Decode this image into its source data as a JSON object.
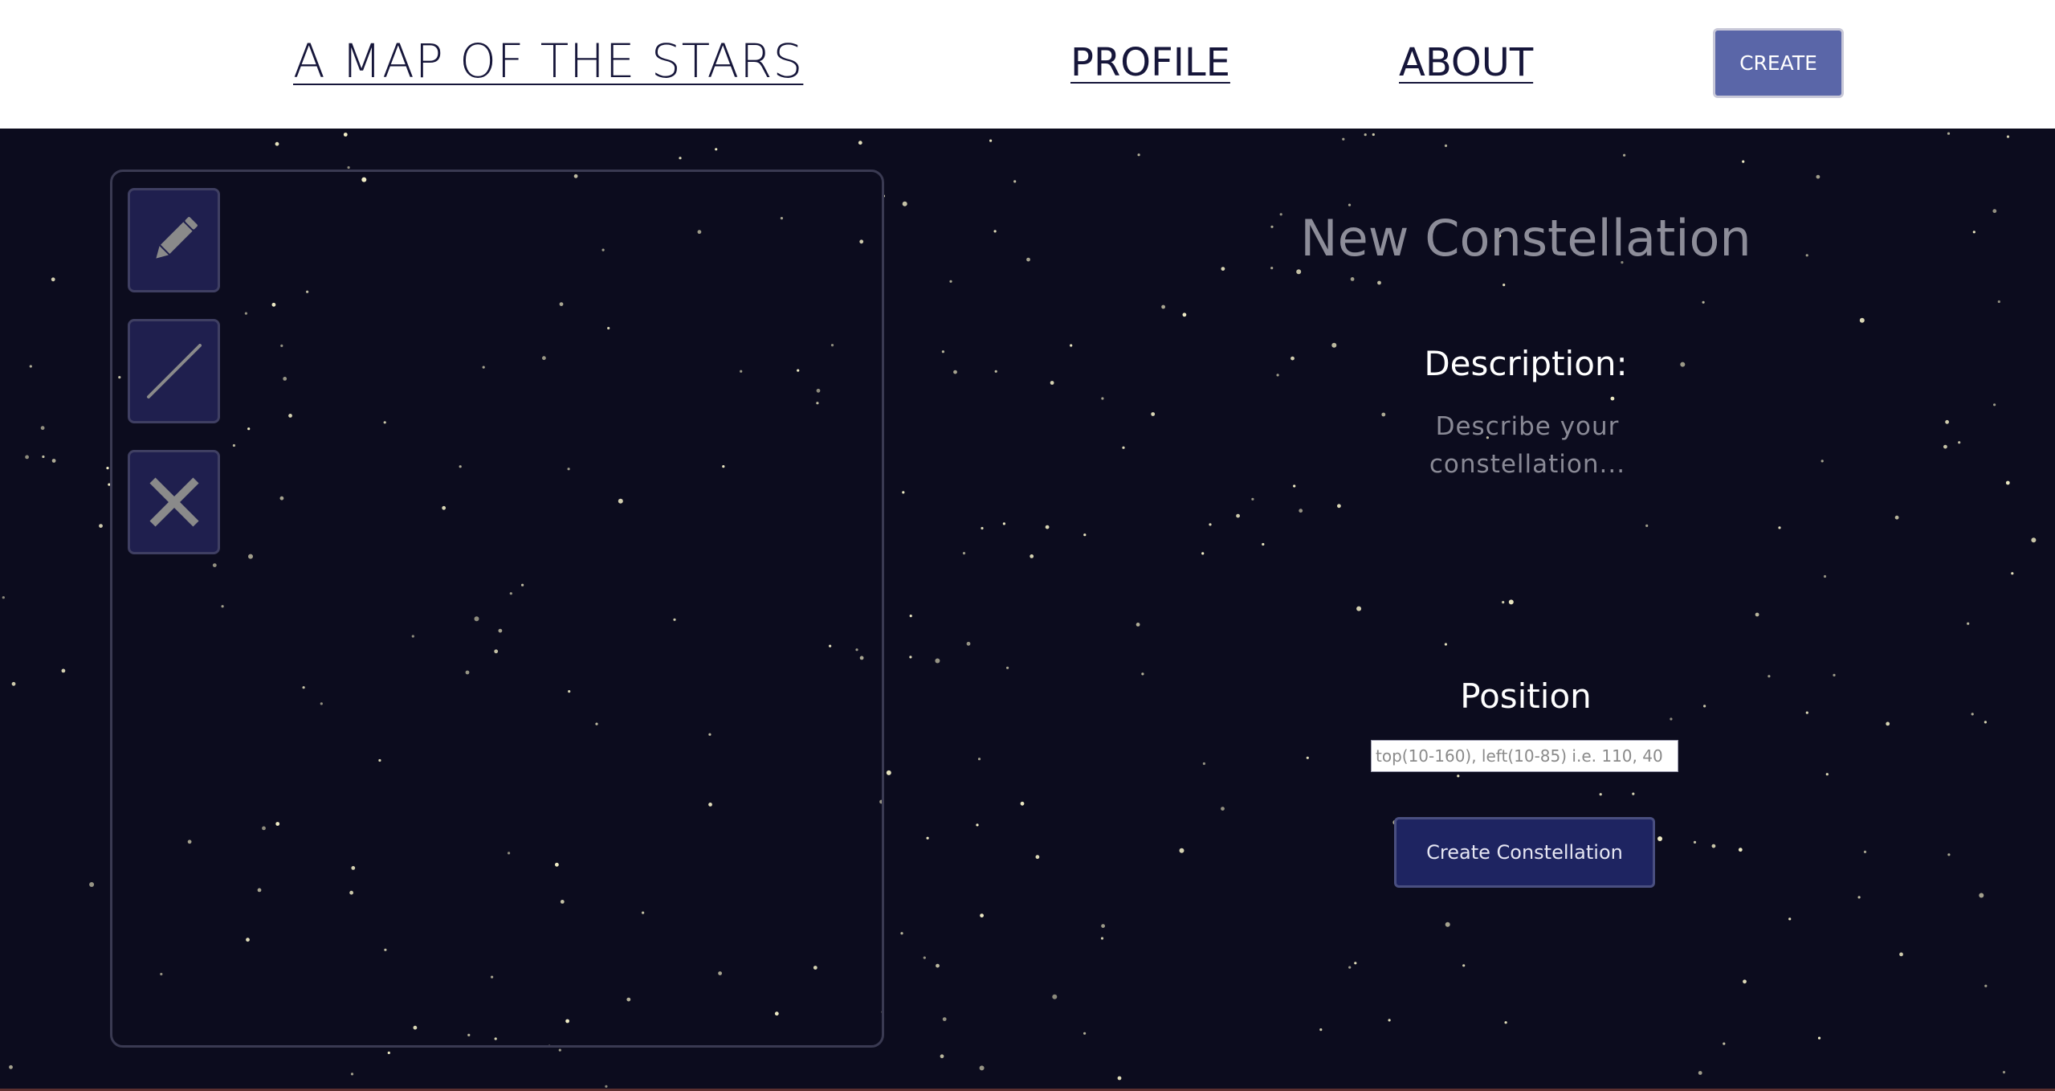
{
  "header": {
    "brand": "A MAP OF THE STARS",
    "nav": {
      "profile": "PROFILE",
      "about": "ABOUT"
    },
    "create_label": "CREATE"
  },
  "tools": [
    {
      "name": "pencil",
      "icon": "pencil-icon"
    },
    {
      "name": "line",
      "icon": "line-icon"
    },
    {
      "name": "delete",
      "icon": "close-icon"
    }
  ],
  "form": {
    "title": "New Constellation",
    "description_label": "Description:",
    "description_placeholder": "Describe your constellation...",
    "position_label": "Position",
    "position_placeholder": "top(10-160), left(10-85) i.e. 110, 40",
    "submit_label": "Create Constellation"
  },
  "colors": {
    "background": "#0c0c1e",
    "header_bg": "#ffffff",
    "brand_text": "#16163a",
    "create_button": "#5a66a8",
    "submit_button": "#1e2461",
    "tool_button": "#1f1f4e",
    "star": "#f4f0c8"
  }
}
